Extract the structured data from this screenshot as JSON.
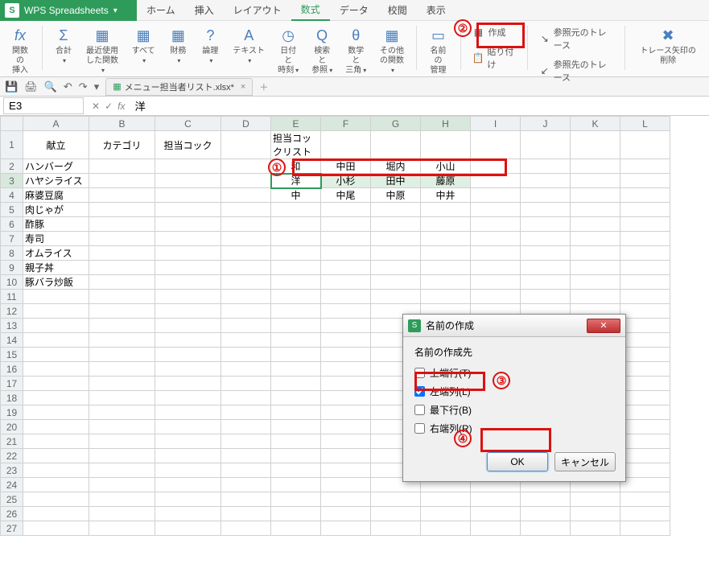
{
  "app": {
    "title": "WPS Spreadsheets"
  },
  "menu": {
    "items": [
      "ホーム",
      "挿入",
      "レイアウト",
      "数式",
      "データ",
      "校閲",
      "表示"
    ],
    "active_index": 3
  },
  "ribbon": {
    "groups": [
      {
        "icon": "fx",
        "label": "関数の\n挿入"
      },
      {
        "icon": "Σ",
        "label": "合計",
        "arrow": true
      },
      {
        "icon": "▦",
        "label": "最近使用\nした関数",
        "arrow": true
      },
      {
        "icon": "▦",
        "label": "すべて",
        "arrow": true
      },
      {
        "icon": "▦",
        "label": "財務",
        "arrow": true
      },
      {
        "icon": "?",
        "label": "論理",
        "arrow": true
      },
      {
        "icon": "A",
        "label": "テキスト",
        "arrow": true
      },
      {
        "icon": "◷",
        "label": "日付と\n時刻",
        "arrow": true
      },
      {
        "icon": "Q",
        "label": "検索と\n参照",
        "arrow": true
      },
      {
        "icon": "θ",
        "label": "数学と\n三角",
        "arrow": true
      },
      {
        "icon": "▦",
        "label": "その他\nの関数",
        "arrow": true
      },
      {
        "icon": "▭",
        "label": "名前の\n管理"
      }
    ],
    "right_top": [
      {
        "icon": "▦",
        "label": "作成"
      },
      {
        "icon": "📋",
        "label": "貼り付け"
      }
    ],
    "right_side": [
      {
        "icon": "↘",
        "label": "参照元のトレース"
      },
      {
        "icon": "↙",
        "label": "参照先のトレース"
      }
    ],
    "far_right": {
      "icon": "✖",
      "label": "トレース矢印の削除"
    }
  },
  "quickbar": {
    "file_tab": "メニュー担当者リスト.xlsx*"
  },
  "formulabar": {
    "cell_ref": "E3",
    "formula": "洋"
  },
  "columns": [
    "A",
    "B",
    "C",
    "D",
    "E",
    "F",
    "G",
    "H",
    "I",
    "J",
    "K",
    "L"
  ],
  "rows": 27,
  "selection": {
    "active": "E3",
    "range_cols": [
      4,
      5,
      6,
      7
    ],
    "range_row": 2
  },
  "cells": {
    "A1": "献立",
    "B1": "カテゴリ",
    "C1": "担当コック",
    "A2": "ハンバーグ",
    "A3": "ハヤシライス",
    "A4": "麻婆豆腐",
    "A5": "肉じゃが",
    "A6": "酢豚",
    "A7": "寿司",
    "A8": "オムライス",
    "A9": "親子丼",
    "A10": "豚バラ炒飯",
    "E1": "担当コックリスト",
    "E2": "和",
    "F2": "中田",
    "G2": "堀内",
    "H2": "小山",
    "E3": "洋",
    "F3": "小杉",
    "G3": "田中",
    "H3": "藤原",
    "E4": "中",
    "F4": "中尾",
    "G4": "中原",
    "H4": "中井"
  },
  "dialog": {
    "title": "名前の作成",
    "section": "名前の作成先",
    "options": [
      {
        "label": "上端行(T)",
        "checked": false
      },
      {
        "label": "左端列(L)",
        "checked": true
      },
      {
        "label": "最下行(B)",
        "checked": false
      },
      {
        "label": "右端列(R)",
        "checked": false
      }
    ],
    "ok": "OK",
    "cancel": "キャンセル"
  },
  "annotations": {
    "a1": "①",
    "a2": "②",
    "a3": "③",
    "a4": "④"
  }
}
